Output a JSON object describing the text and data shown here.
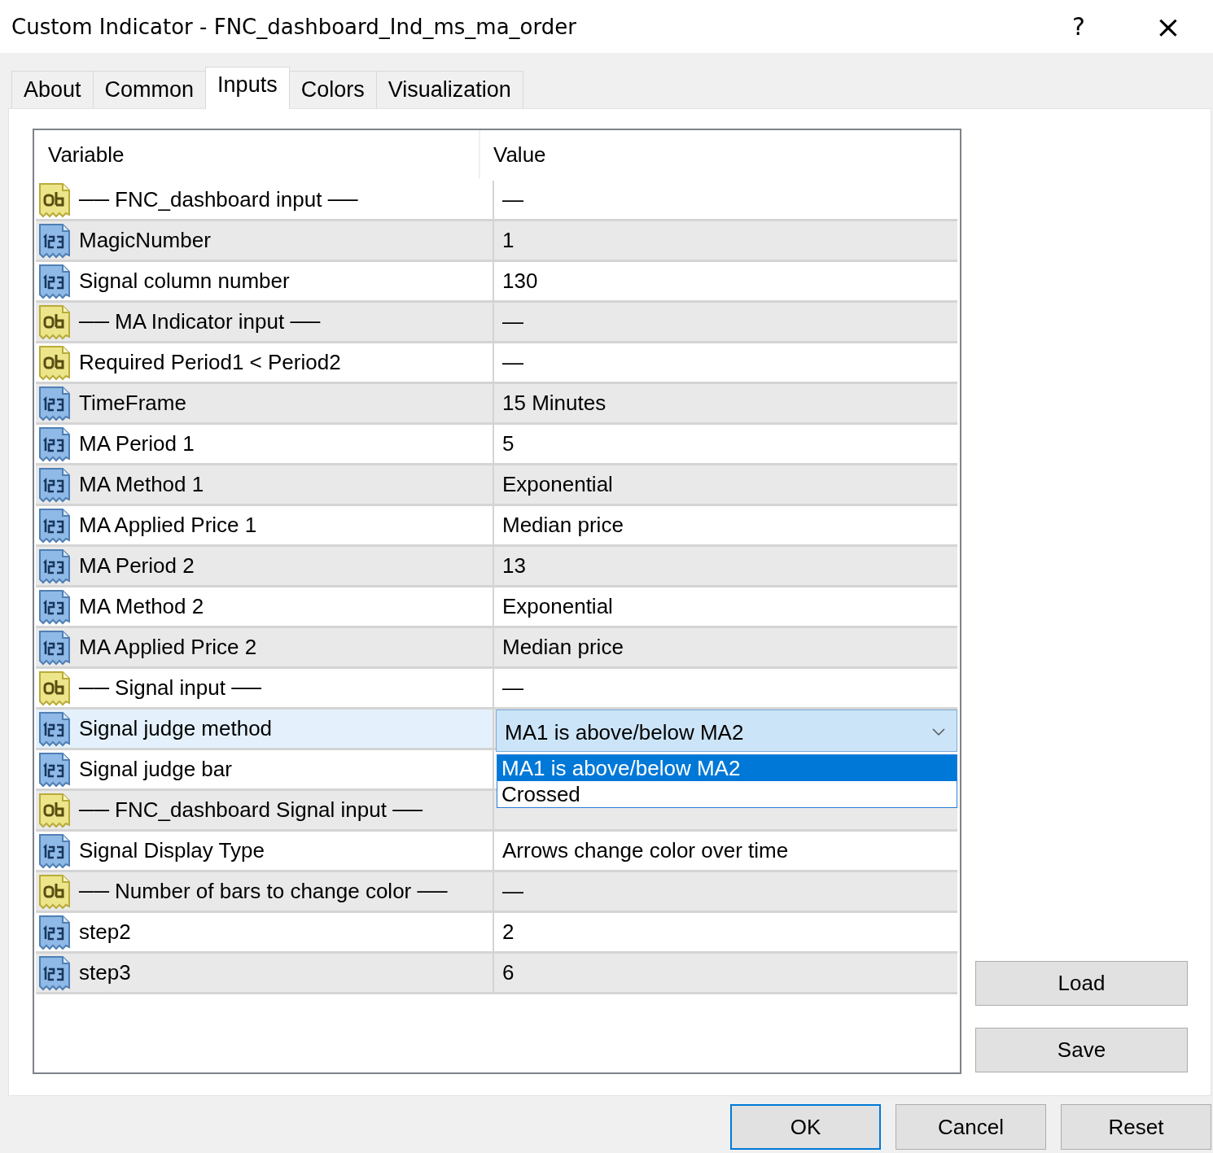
{
  "window": {
    "title": "Custom Indicator - FNC_dashboard_Ind_ms_ma_order",
    "help": "?",
    "close": "×"
  },
  "tabs": [
    {
      "label": "About",
      "selected": false
    },
    {
      "label": "Common",
      "selected": false
    },
    {
      "label": "Inputs",
      "selected": true
    },
    {
      "label": "Colors",
      "selected": false
    },
    {
      "label": "Visualization",
      "selected": false
    }
  ],
  "table": {
    "columns": [
      "Variable",
      "Value"
    ],
    "rows": [
      {
        "kind": "string",
        "variable": "── FNC_dashboard input ──",
        "value": "—",
        "selected": false
      },
      {
        "kind": "number",
        "variable": "MagicNumber",
        "value": "1",
        "selected": false
      },
      {
        "kind": "number",
        "variable": "Signal column number",
        "value": "130",
        "selected": false
      },
      {
        "kind": "string",
        "variable": "── MA Indicator input ──",
        "value": "—",
        "selected": false
      },
      {
        "kind": "string",
        "variable": "Required Period1 < Period2",
        "value": "—",
        "selected": false
      },
      {
        "kind": "number",
        "variable": "TimeFrame",
        "value": "15 Minutes",
        "selected": false
      },
      {
        "kind": "number",
        "variable": "MA Period 1",
        "value": "5",
        "selected": false
      },
      {
        "kind": "number",
        "variable": "MA Method 1",
        "value": "Exponential",
        "selected": false
      },
      {
        "kind": "number",
        "variable": "MA Applied Price 1",
        "value": "Median price",
        "selected": false
      },
      {
        "kind": "number",
        "variable": "MA Period 2",
        "value": "13",
        "selected": false
      },
      {
        "kind": "number",
        "variable": "MA Method 2",
        "value": "Exponential",
        "selected": false
      },
      {
        "kind": "number",
        "variable": "MA Applied Price 2",
        "value": "Median price",
        "selected": false
      },
      {
        "kind": "string",
        "variable": "── Signal input ──",
        "value": "—",
        "selected": false
      },
      {
        "kind": "number",
        "variable": "Signal judge method",
        "selected": true,
        "dropdown": {
          "value": "MA1 is above/below MA2",
          "options": [
            {
              "label": "MA1 is above/below MA2",
              "selected": true
            },
            {
              "label": "Crossed",
              "selected": false
            }
          ]
        }
      },
      {
        "kind": "number",
        "variable": "Signal judge bar",
        "selected": false
      },
      {
        "kind": "string",
        "variable": "── FNC_dashboard Signal input ──",
        "selected": false
      },
      {
        "kind": "number",
        "variable": "Signal Display Type",
        "value": "Arrows change color over time",
        "selected": false
      },
      {
        "kind": "string",
        "variable": "── Number of bars to change color ──",
        "value": "—",
        "selected": false
      },
      {
        "kind": "number",
        "variable": "step2",
        "value": "2",
        "selected": false
      },
      {
        "kind": "number",
        "variable": "step3",
        "value": "6",
        "selected": false
      }
    ]
  },
  "side_buttons": [
    "Load",
    "Save"
  ],
  "buttons": [
    {
      "label": "OK",
      "default": true
    },
    {
      "label": "Cancel",
      "default": false
    },
    {
      "label": "Reset",
      "default": false
    }
  ]
}
